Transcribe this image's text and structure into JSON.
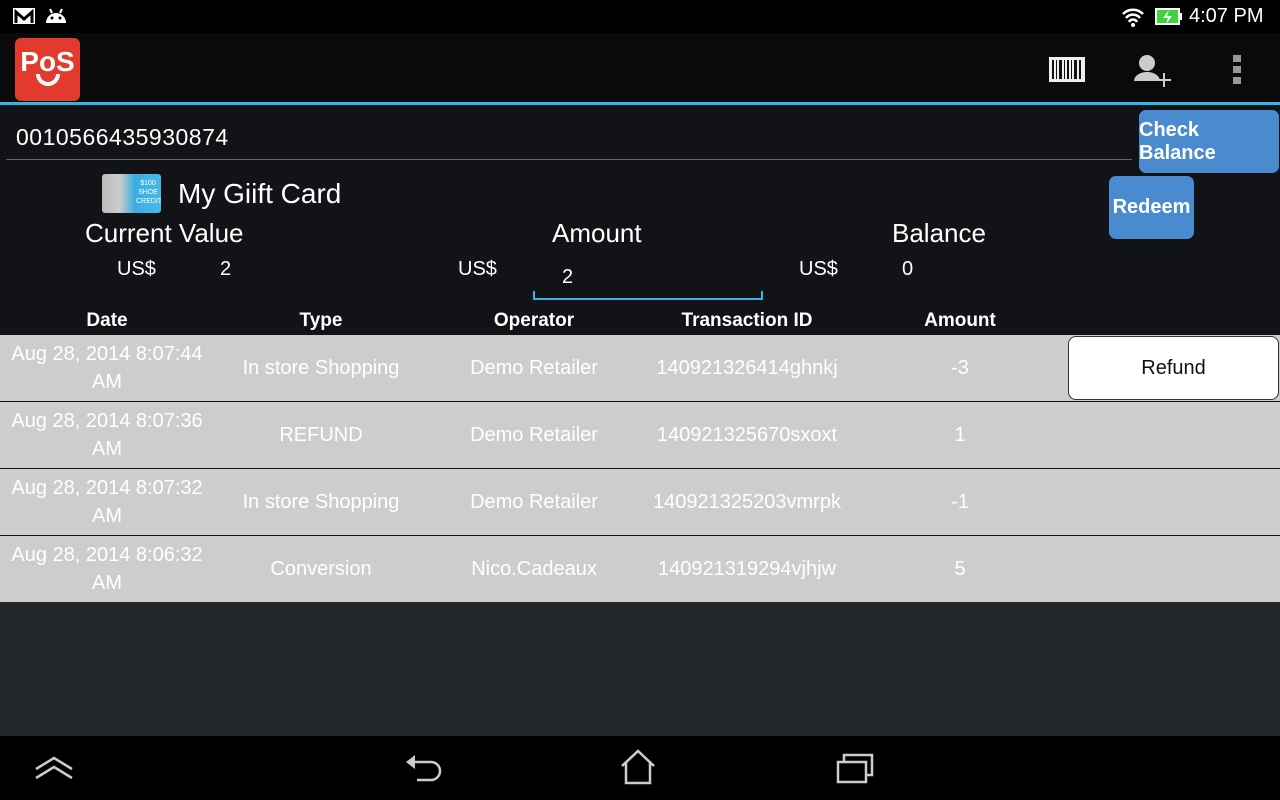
{
  "status_bar": {
    "time": "4:07 PM",
    "icons": [
      "gmail-icon",
      "android-icon",
      "wifi-icon",
      "battery-charging-icon"
    ]
  },
  "action_bar": {
    "logo_text": "PoS",
    "icons": [
      "barcode-icon",
      "add-user-icon",
      "overflow-menu-icon"
    ]
  },
  "card_number": "0010566435930874",
  "check_balance_label": "Check Balance",
  "redeem_label": "Redeem",
  "card": {
    "name": "My Giift Card",
    "image_text": "$100 SHOE CREDIT"
  },
  "summary": {
    "current_value_label": "Current Value",
    "current_currency": "US$",
    "current_value": "2",
    "amount_label": "Amount",
    "amount_currency": "US$",
    "amount_value": "2",
    "balance_label": "Balance",
    "balance_currency": "US$",
    "balance_value": "0"
  },
  "table": {
    "headers": [
      "Date",
      "Type",
      "Operator",
      "Transaction ID",
      "Amount"
    ],
    "rows": [
      {
        "date": "Aug 28, 2014 8:07:44 AM",
        "type": "In store Shopping",
        "operator": "Demo Retailer",
        "txid": "140921326414ghnkj",
        "amount": "-3",
        "action": "Refund"
      },
      {
        "date": "Aug 28, 2014 8:07:36 AM",
        "type": "REFUND",
        "operator": "Demo Retailer",
        "txid": "140921325670sxoxt",
        "amount": "1"
      },
      {
        "date": "Aug 28, 2014 8:07:32 AM",
        "type": "In store Shopping",
        "operator": "Demo Retailer",
        "txid": "140921325203vmrpk",
        "amount": "-1"
      },
      {
        "date": "Aug 28, 2014 8:06:32 AM",
        "type": "Conversion",
        "operator": "Nico.Cadeaux",
        "txid": "140921319294vjhjw",
        "amount": "5"
      }
    ]
  },
  "nav_bar": {
    "icons": [
      "recent-up-icon",
      "back-icon",
      "home-icon",
      "recent-apps-icon"
    ]
  },
  "colors": {
    "accent": "#33b5e5",
    "button": "#4a8bd0",
    "logo": "#e23b2e",
    "row": "#cdcdcd"
  }
}
